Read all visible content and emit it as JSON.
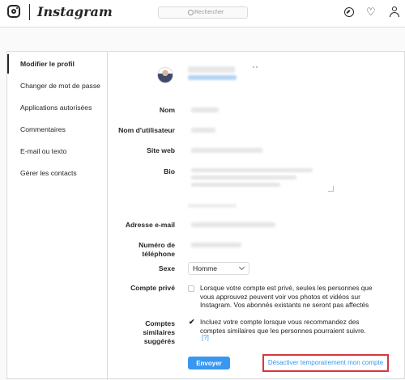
{
  "header": {
    "brand": "Instagram",
    "search_placeholder": "Rechercher",
    "icons": [
      "instagram-logo-icon",
      "compass-icon",
      "heart-icon",
      "user-icon"
    ]
  },
  "sidebar": {
    "items": [
      {
        "label": "Modifier le profil",
        "active": true
      },
      {
        "label": "Changer de mot de passe"
      },
      {
        "label": "Applications autorisées"
      },
      {
        "label": "Commentaires"
      },
      {
        "label": "E-mail ou texto"
      },
      {
        "label": "Gérer les contacts"
      }
    ]
  },
  "form": {
    "name_label": "Nom",
    "username_label": "Nom d'utilisateur",
    "website_label": "Site web",
    "bio_label": "Bio",
    "email_label": "Adresse e-mail",
    "phone_label_1": "Numéro de",
    "phone_label_2": "téléphone",
    "gender_label": "Sexe",
    "gender_value": "Homme",
    "private_label": "Compte privé",
    "private_desc_1": "Lorsque votre compte est privé, seules les personnes que",
    "private_desc_2": "vous approuvez peuvent voir vos photos et vidéos sur",
    "private_desc_3": "Instagram. Vos abonnés existants ne seront pas affectés",
    "private_checked": false,
    "similar_label_1": "Comptes",
    "similar_label_2": "similaires",
    "similar_label_3": "suggérés",
    "similar_desc_1": "Incluez votre compte lorsque vous recommandez des",
    "similar_desc_2": "comptes similaires que les personnes pourraient suivre.",
    "similar_help": "[?]",
    "similar_checked": true,
    "checkmark": "✔",
    "submit_label": "Envoyer",
    "disable_label": "Désactiver temporairement mon compte"
  },
  "colors": {
    "accent": "#3897f0",
    "highlight_border": "#d9363e",
    "border": "#dbdbdb"
  }
}
